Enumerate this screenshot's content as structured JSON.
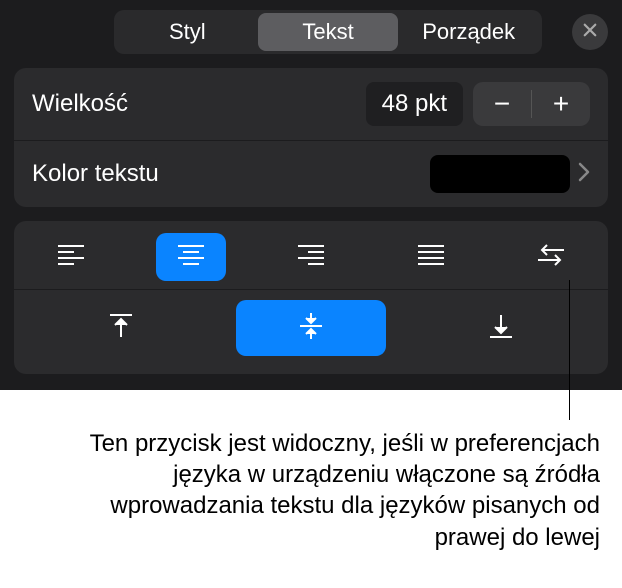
{
  "tabs": {
    "style": "Styl",
    "text": "Tekst",
    "arrange": "Porządek"
  },
  "size": {
    "label": "Wielkość",
    "value": "48 pkt"
  },
  "textColor": {
    "label": "Kolor tekstu",
    "value": "#000000"
  },
  "caption": "Ten przycisk jest widoczny, jeśli w preferencjach języka w urządzeniu włączone są źródła wprowadzania tekstu dla języków pisanych od prawej do lewej"
}
